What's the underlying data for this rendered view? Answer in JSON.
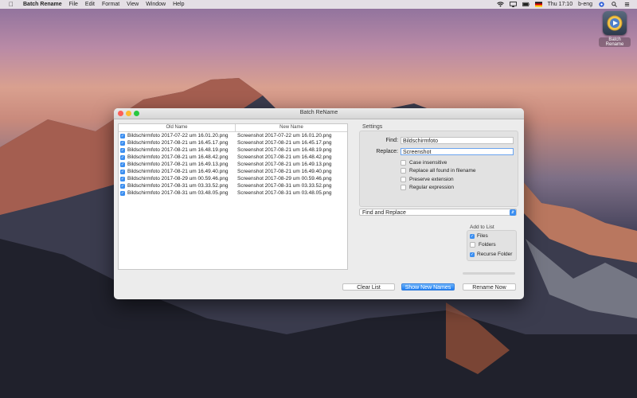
{
  "menubar": {
    "app_name": "Batch Rename",
    "items": [
      "File",
      "Edit",
      "Format",
      "View",
      "Window",
      "Help"
    ],
    "clock": "Thu 17:10",
    "user": "b-eng"
  },
  "desktop_icon": {
    "label": "Batch Rename"
  },
  "window": {
    "title": "Batch ReName",
    "table": {
      "col_old": "Old Name",
      "col_new": "New Name",
      "rows": [
        {
          "old": "Bildschirmfoto 2017-07-22 um 16.01.20.png",
          "new": "Screenshot  2017-07-22 um 16.01.20.png"
        },
        {
          "old": "Bildschirmfoto 2017-08-21 um 16.45.17.png",
          "new": "Screenshot  2017-08-21 um 16.45.17.png"
        },
        {
          "old": "Bildschirmfoto 2017-08-21 um 16.48.19.png",
          "new": "Screenshot  2017-08-21 um 16.48.19.png"
        },
        {
          "old": "Bildschirmfoto 2017-08-21 um 16.48.42.png",
          "new": "Screenshot  2017-08-21 um 16.48.42.png"
        },
        {
          "old": "Bildschirmfoto 2017-08-21 um 16.49.13.png",
          "new": "Screenshot  2017-08-21 um 16.49.13.png"
        },
        {
          "old": "Bildschirmfoto 2017-08-21 um 16.49.40.png",
          "new": "Screenshot  2017-08-21 um 16.49.40.png"
        },
        {
          "old": "Bildschirmfoto 2017-08-29 um 00.59.46.png",
          "new": "Screenshot  2017-08-29 um 00.59.46.png"
        },
        {
          "old": "Bildschirmfoto 2017-08-31 um 03.33.52.png",
          "new": "Screenshot  2017-08-31 um 03.33.52.png"
        },
        {
          "old": "Bildschirmfoto 2017-08-31 um 03.48.05.png",
          "new": "Screenshot  2017-08-31 um 03.48.05.png"
        }
      ]
    },
    "settings": {
      "title": "Settings",
      "find_label": "Find:",
      "find_value": "Bildschirmfoto",
      "replace_label": "Replace:",
      "replace_value": "Screenshot",
      "options": [
        "Case insensitive",
        "Replace all found in filename",
        "Preserve extension",
        "Regular expression"
      ]
    },
    "mode_select": {
      "value": "Find and Replace"
    },
    "add_to_list": {
      "title": "Add to List",
      "files": "Files",
      "folders": "Folders",
      "recurse": "Recurse Folder"
    },
    "buttons": {
      "clear": "Clear List",
      "show": "Show New Names",
      "rename": "Rename Now"
    }
  }
}
